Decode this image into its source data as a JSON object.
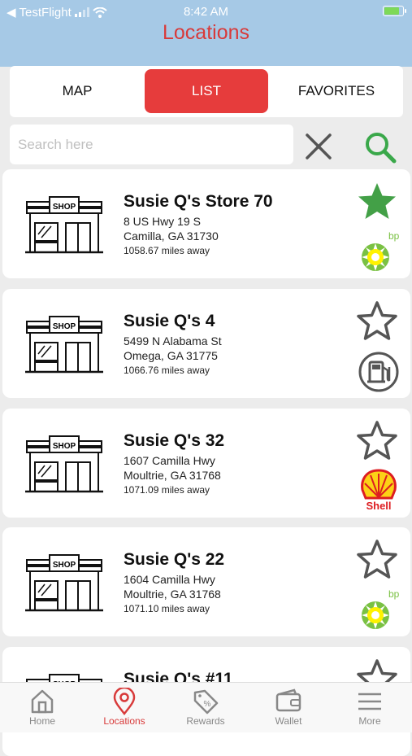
{
  "status_bar": {
    "carrier": "TestFlight",
    "time": "8:42 AM"
  },
  "header": {
    "title": "Locations"
  },
  "tabs": [
    "MAP",
    "LIST",
    "FAVORITES"
  ],
  "search": {
    "placeholder": "Search here"
  },
  "colors": {
    "accent": "#e63c3c",
    "header_bg": "#a6c9e6",
    "favorite_green": "#43a047",
    "search_green": "#3aa84a"
  },
  "locations": [
    {
      "name": "Susie Q's Store 70",
      "address1": "8 US Hwy 19 S",
      "address2": "Camilla, GA  31730",
      "distance": "1058.67 miles away",
      "favorite": true,
      "brand": "bp"
    },
    {
      "name": "Susie Q's 4",
      "address1": "5499 N Alabama St",
      "address2": "Omega, GA  31775",
      "distance": "1066.76 miles away",
      "favorite": false,
      "brand": "fuel-pump-icon"
    },
    {
      "name": "Susie Q's 32",
      "address1": "1607 Camilla Hwy",
      "address2": "Moultrie, GA  31768",
      "distance": "1071.09 miles away",
      "favorite": false,
      "brand": "Shell"
    },
    {
      "name": "Susie Q's 22",
      "address1": "1604 Camilla Hwy",
      "address2": "Moultrie, GA  31768",
      "distance": "1071.10 miles away",
      "favorite": false,
      "brand": "bp"
    },
    {
      "name": "Susie Q's #11",
      "favorite": false
    }
  ],
  "shop_label": "SHOP",
  "nav": [
    {
      "label": "Home",
      "icon": "home-icon"
    },
    {
      "label": "Locations",
      "icon": "location-pin-icon",
      "active": true
    },
    {
      "label": "Rewards",
      "icon": "percent-tag-icon"
    },
    {
      "label": "Wallet",
      "icon": "wallet-icon"
    },
    {
      "label": "More",
      "icon": "menu-icon"
    }
  ]
}
